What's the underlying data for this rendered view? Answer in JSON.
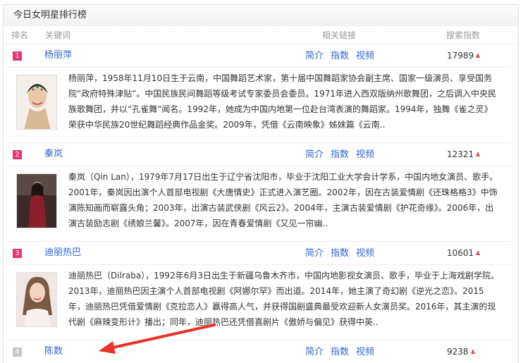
{
  "panel": {
    "title": "今日女明星排行榜"
  },
  "columns": {
    "rank": "排名",
    "keyword": "关键词",
    "links": "相关链接",
    "search": "搜索指数"
  },
  "links": {
    "intro": "简介",
    "index": "指数",
    "video": "视频"
  },
  "colors": {
    "rank_top": "#e8356b",
    "rank_other": "#c7c7c7",
    "link": "#3366cc",
    "up_arrow": "#e84a4a",
    "annotation": "#e8332b"
  },
  "items": [
    {
      "rank": "1",
      "name": "杨丽萍",
      "count": "17989",
      "trend": "up",
      "desc": "杨丽萍，1958年11月10日生于云南，中国舞蹈艺术家，第十届中国舞蹈家协会副主席、国家一级演员、享受国务院“政府特殊津贴”。中国民族民间舞蹈等级考试专家委员会委员。1971年进入西双版纳州歌舞团，之后调入中央民族歌舞团，并以“孔雀舞”闻名。1992年，她成为中国内地第一位赴台湾表演的舞蹈家。1994年，独舞《雀之灵》荣获中华民族20世纪舞蹈经典作品金奖。2009年，凭借《云南映象》姊妹篇《云南.."
    },
    {
      "rank": "2",
      "name": "秦岚",
      "count": "12321",
      "trend": "up",
      "desc": "秦岚（Qin Lan），1979年7月17日出生于辽宁省沈阳市，毕业于沈阳工业大学会计学系，中国内地女演员、歌手。2001年，秦岚因出演个人首部电视剧《大唐情史》正式进入演艺圈。2002年，因在古装爱情剧《还珠格格3》中饰演陈知画而崭露头角；2003年，出演古装武侠剧《风云2》。2004年，主演古装爱情剧《护花奇缘》。2006年，出演古装励志剧《绣娘兰馨》。2007年，因在青春爱情剧《又见一帘幽.."
    },
    {
      "rank": "3",
      "name": "迪丽热巴",
      "count": "10601",
      "trend": "up",
      "desc": "迪丽热巴（Dilraba），1992年6月3日出生于新疆乌鲁木齐市，中国内地影视女演员、歌手，毕业于上海戏剧学院。2013年，迪丽热巴因主演个人首部电视剧《阿娜尔罕》而出道。2014年，她主演了奇幻剧《逆光之恋》。2015年，迪丽热巴凭借爱情剧《克拉恋人》赢得高人气，并获得国剧盛典最受欢迎新人女演员奖。2016年，其主演的现代剧《麻辣变形计》播出；同年，迪丽热巴还凭借喜剧片《傲娇与偏见》获得中英.."
    },
    {
      "rank": "4",
      "name": "陈数",
      "count": "9238",
      "trend": "up"
    }
  ]
}
